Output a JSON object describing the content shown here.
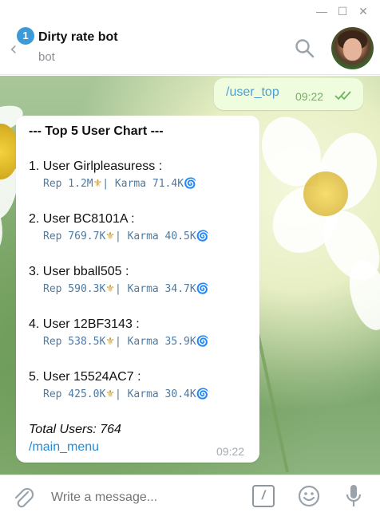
{
  "window": {
    "minimize_glyph": "—",
    "maximize_glyph": "☐",
    "close_glyph": "✕"
  },
  "header": {
    "title": "Dirty rate bot",
    "subtitle": "bot",
    "unread_count": "1",
    "icons": [
      "back-arrow-icon",
      "search-icon",
      "avatar"
    ]
  },
  "messages": {
    "outgoing": {
      "text": "/user_top",
      "time": "09:22",
      "status": "read"
    },
    "incoming": {
      "heading": "--- Top 5 User Chart ---",
      "entries": [
        {
          "title": "1. User Girlpleasuress :",
          "rep_prefix": "Rep 1.2M",
          "karma": "| Karma 71.4K"
        },
        {
          "title": "2. User BC8101A :",
          "rep_prefix": "Rep 769.7K",
          "karma": "| Karma 40.5K"
        },
        {
          "title": "3. User bball505 :",
          "rep_prefix": "Rep 590.3K",
          "karma": "| Karma 34.7K"
        },
        {
          "title": "4. User 12BF3143 :",
          "rep_prefix": "Rep 538.5K",
          "karma": "| Karma 35.9K"
        },
        {
          "title": "5. User 15524AC7 :",
          "rep_prefix": "Rep 425.0K",
          "karma": "| Karma 30.4K"
        }
      ],
      "fleur_glyph": "⚜",
      "swirl_glyph": "🌀",
      "total": "Total Users: 764",
      "link": "/main_menu",
      "time": "09:22"
    }
  },
  "composer": {
    "placeholder": "Write a message...",
    "command_glyph": "/"
  },
  "colors": {
    "accent": "#4a9fd6",
    "outgoing_bubble": "#effdde",
    "unread_badge": "#3d9ad9"
  }
}
